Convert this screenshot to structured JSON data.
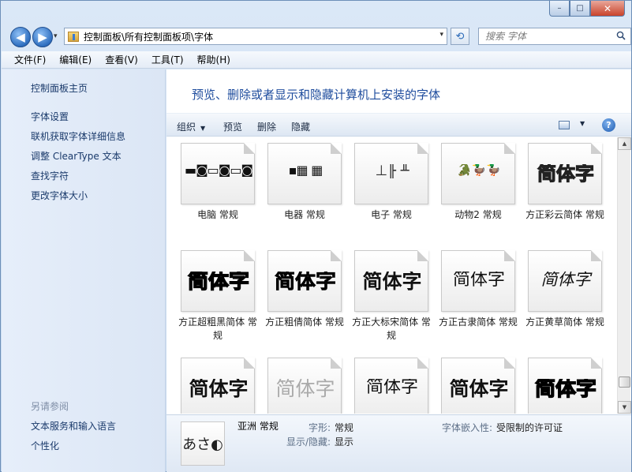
{
  "window": {
    "minimize": "–",
    "maximize": "□",
    "close": "✕"
  },
  "nav": {
    "back": "◀",
    "forward": "▶",
    "history_dropdown": "▾",
    "address": "控制面板\\所有控制面板项\\字体",
    "address_dropdown": "▾",
    "refresh": "⟲",
    "search_placeholder": "搜索 字体"
  },
  "menu": [
    {
      "label": "文件(F)"
    },
    {
      "label": "编辑(E)"
    },
    {
      "label": "查看(V)"
    },
    {
      "label": "工具(T)"
    },
    {
      "label": "帮助(H)"
    }
  ],
  "sidebar": {
    "home": "控制面板主页",
    "links": [
      {
        "label": "字体设置"
      },
      {
        "label": "联机获取字体详细信息"
      },
      {
        "label": "调整 ClearType 文本"
      },
      {
        "label": "查找字符"
      },
      {
        "label": "更改字体大小"
      }
    ],
    "see_also_label": "另请参阅",
    "see_also": [
      {
        "label": "文本服务和输入语言"
      },
      {
        "label": "个性化"
      }
    ]
  },
  "main": {
    "title": "预览、删除或者显示和隐藏计算机上安装的字体"
  },
  "commands": {
    "organize": "组织",
    "organize_arrow": "▼",
    "preview": "预览",
    "delete": "删除",
    "hide": "隐藏",
    "view_arrow": "▼",
    "help": "?"
  },
  "fonts": [
    {
      "name": "电脑 常规",
      "sample": "▬◙▭◙▭◙",
      "style": "sym"
    },
    {
      "name": "电器 常规",
      "sample": "▪▦ ▦",
      "style": "sym"
    },
    {
      "name": "电子 常规",
      "sample": "⊥╟ ╨",
      "style": "sym2"
    },
    {
      "name": "动物2 常规",
      "sample": "🐊🦆🦆",
      "style": "sym3"
    },
    {
      "name": "方正彩云简体 常规",
      "sample": "简体字",
      "style": "outline"
    },
    {
      "name": "方正超粗黑简体 常规",
      "sample": "简体字",
      "style": "black"
    },
    {
      "name": "方正粗倩简体 常规",
      "sample": "简体字",
      "style": "heavy"
    },
    {
      "name": "方正大标宋简体 常规",
      "sample": "简体字",
      "style": "bold"
    },
    {
      "name": "方正古隶简体 常规",
      "sample": "简体字",
      "style": "light"
    },
    {
      "name": "方正黄草简体 常规",
      "sample": "简体字",
      "style": "script"
    },
    {
      "name": "",
      "sample": "简体字",
      "style": "bold"
    },
    {
      "name": "",
      "sample": "简体字",
      "style": "grey"
    },
    {
      "name": "",
      "sample": "简体字",
      "style": "light"
    },
    {
      "name": "",
      "sample": "简体字",
      "style": "bold"
    },
    {
      "name": "",
      "sample": "简体字",
      "style": "black"
    }
  ],
  "details": {
    "thumb": "あさ◐",
    "name": "亚洲 常规",
    "shape_label": "字形:",
    "shape_value": "常规",
    "visibility_label": "显示/隐藏:",
    "visibility_value": "显示",
    "embed_label": "字体嵌入性:",
    "embed_value": "受限制的许可证"
  }
}
